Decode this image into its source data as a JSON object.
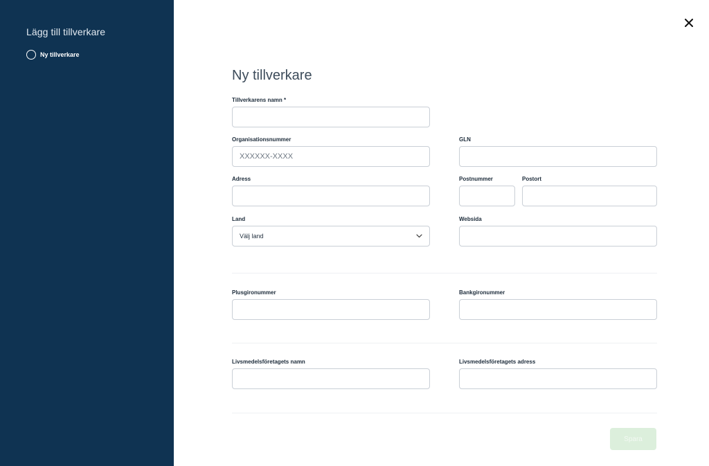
{
  "sidebar": {
    "title": "Lägg till tillverkare",
    "steps": [
      {
        "label": "Ny tillverkare"
      }
    ]
  },
  "form": {
    "title": "Ny tillverkare",
    "fields": {
      "name": {
        "label": "Tillverkarens namn *",
        "value": ""
      },
      "org_number": {
        "label": "Organisationsnummer",
        "placeholder": "XXXXXX-XXXX",
        "value": ""
      },
      "gln": {
        "label": "GLN",
        "value": ""
      },
      "address": {
        "label": "Adress",
        "value": ""
      },
      "postal_code": {
        "label": "Postnummer",
        "value": ""
      },
      "city": {
        "label": "Postort",
        "value": ""
      },
      "country": {
        "label": "Land",
        "value": "Välj land"
      },
      "website": {
        "label": "Websida",
        "value": ""
      },
      "plusgiro": {
        "label": "Plusgironummer",
        "value": ""
      },
      "bankgiro": {
        "label": "Bankgironummer",
        "value": ""
      },
      "food_company_name": {
        "label": "Livsmedelsföretagets namn",
        "value": ""
      },
      "food_company_address": {
        "label": "Livsmedelsföretagets adress",
        "value": ""
      }
    },
    "save_label": "Spara"
  },
  "colors": {
    "sidebar_bg": "#0f3352",
    "save_disabled_bg": "#dcefdc"
  },
  "icons": {
    "close": "close-icon",
    "step": "circle-icon",
    "dropdown": "chevron-down-icon"
  }
}
